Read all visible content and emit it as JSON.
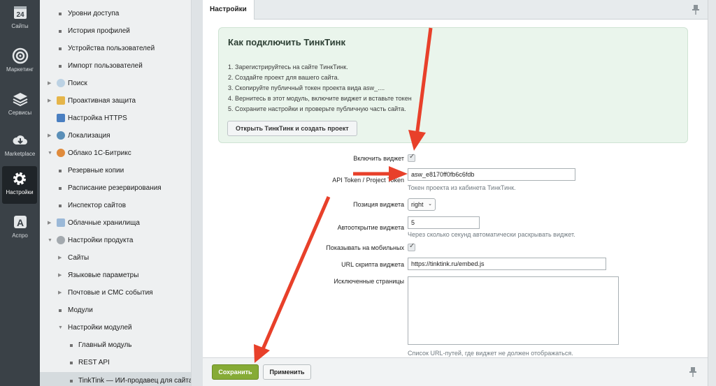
{
  "rail": {
    "items": [
      {
        "label": "Сайты",
        "icon": "calendar-24-icon",
        "badge": "24"
      },
      {
        "label": "Маркетинг",
        "icon": "target-icon"
      },
      {
        "label": "Сервисы",
        "icon": "layers-icon"
      },
      {
        "label": "Marketplace",
        "icon": "cloud-download-icon"
      },
      {
        "label": "Настройки",
        "icon": "gear-icon"
      },
      {
        "label": "Аспро",
        "icon": "aspro-a-icon",
        "badge": "A"
      }
    ]
  },
  "tree": {
    "items": [
      {
        "label": "Уровни доступа"
      },
      {
        "label": "История профилей"
      },
      {
        "label": "Устройства пользователей"
      },
      {
        "label": "Импорт пользователей"
      },
      {
        "label": "Поиск"
      },
      {
        "label": "Проактивная защита"
      },
      {
        "label": "Настройка HTTPS"
      },
      {
        "label": "Локализация"
      },
      {
        "label": "Облако 1С-Битрикс"
      },
      {
        "label": "Резервные копии"
      },
      {
        "label": "Расписание резервирования"
      },
      {
        "label": "Инспектор сайтов"
      },
      {
        "label": "Облачные хранилища"
      },
      {
        "label": "Настройки продукта"
      },
      {
        "label": "Сайты"
      },
      {
        "label": "Языковые параметры"
      },
      {
        "label": "Почтовые и СМС события"
      },
      {
        "label": "Модули"
      },
      {
        "label": "Настройки модулей"
      },
      {
        "label": "Главный модуль"
      },
      {
        "label": "REST API"
      },
      {
        "label": "TinkTink — ИИ-продавец для сайта"
      }
    ]
  },
  "tab": {
    "label": "Настройки"
  },
  "guide": {
    "title": "Как подключить ТинкТинк",
    "steps": [
      "1. Зарегистрируйтесь на сайте ТинкТинк.",
      "2. Создайте проект для вашего сайта.",
      "3. Скопируйте публичный токен проекта вида asw_....",
      "4. Вернитесь в этот модуль, включите виджет и вставьте токен",
      "5. Сохраните настройки и проверьте публичную часть сайта."
    ],
    "button": "Открыть ТинкТинк и создать проект"
  },
  "form": {
    "enable_label": "Включить виджет",
    "token_label": "API Token / Project Token",
    "token_value": "asw_e8170ff0fb6c6fdb",
    "token_hint": "Токен проекта из кабинета ТинкТинк.",
    "position_label": "Позиция виджета",
    "position_value": "right",
    "autoopen_label": "Автооткрытие виджета",
    "autoopen_value": "5",
    "autoopen_hint": "Через сколько секунд автоматически раскрывать виджет.",
    "mobile_label": "Показывать на мобильных",
    "script_label": "URL скрипта виджета",
    "script_value": "https://tinktink.ru/embed.js",
    "excluded_label": "Исключенные страницы",
    "excluded_hint": "Список URL-путей, где виджет не должен отображаться."
  },
  "footer": {
    "save": "Сохранить",
    "apply": "Применить"
  },
  "colors": {
    "accent_green": "#86ab36",
    "arrow_red": "#e8402a",
    "rail_bg": "#3a4147"
  }
}
